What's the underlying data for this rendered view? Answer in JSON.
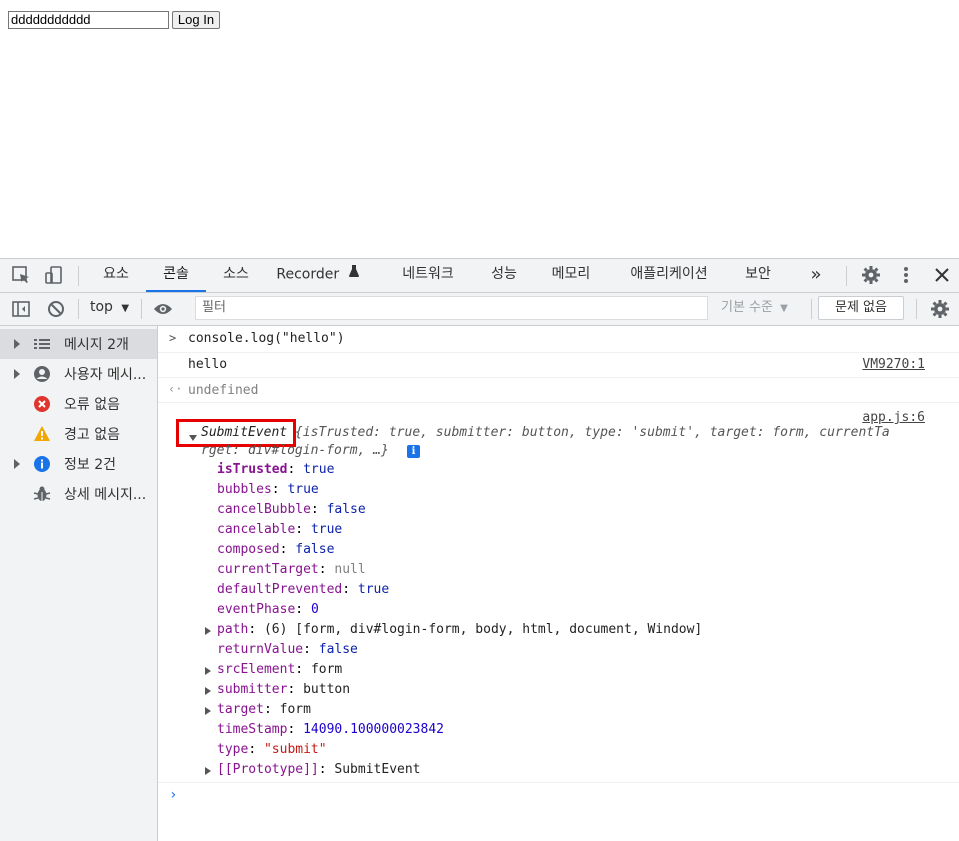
{
  "page": {
    "input_value": "ddddddddddd",
    "login_button": "Log In"
  },
  "devtools": {
    "tabs": [
      "요소",
      "콘솔",
      "소스",
      "Recorder",
      "네트워크",
      "성능",
      "메모리",
      "애플리케이션",
      "보안"
    ],
    "more_tabs": "»",
    "active_tab": "콘솔",
    "toolbar": {
      "context": "top",
      "filter_placeholder": "필터",
      "level": "기본 수준",
      "issues": "문제 없음"
    },
    "sidebar": [
      {
        "label": "메시지 2개",
        "icon": "list-icon",
        "expandable": true,
        "selected": true
      },
      {
        "label": "사용자 메시...",
        "icon": "user-icon",
        "expandable": true
      },
      {
        "label": "오류 없음",
        "icon": "error-icon",
        "expandable": false
      },
      {
        "label": "경고 없음",
        "icon": "warning-icon",
        "expandable": false
      },
      {
        "label": "정보 2건",
        "icon": "info-icon",
        "expandable": true
      },
      {
        "label": "상세 메시지...",
        "icon": "bug-icon",
        "expandable": false
      }
    ],
    "console": {
      "command": "console.log(\"hello\")",
      "output": "hello",
      "output_src": "VM9270:1",
      "return_value": "undefined",
      "event_src": "app.js:6",
      "event_name": "SubmitEvent",
      "event_summary_1": " {isTrusted: true, submitter: button, type: 'submit', target: form, currentTa",
      "event_summary_2": "rget: div#login-form, …}",
      "props": [
        {
          "key": "isTrusted",
          "value": "true",
          "vtype": "bool",
          "bold": true
        },
        {
          "key": "bubbles",
          "value": "true",
          "vtype": "bool"
        },
        {
          "key": "cancelBubble",
          "value": "false",
          "vtype": "bool"
        },
        {
          "key": "cancelable",
          "value": "true",
          "vtype": "bool"
        },
        {
          "key": "composed",
          "value": "false",
          "vtype": "bool"
        },
        {
          "key": "currentTarget",
          "value": "null",
          "vtype": "null"
        },
        {
          "key": "defaultPrevented",
          "value": "true",
          "vtype": "bool"
        },
        {
          "key": "eventPhase",
          "value": "0",
          "vtype": "num"
        },
        {
          "key": "path",
          "value": "(6) [form, div#login-form, body, html, document, Window]",
          "vtype": "obj",
          "expandable": true
        },
        {
          "key": "returnValue",
          "value": "false",
          "vtype": "bool"
        },
        {
          "key": "srcElement",
          "value": "form",
          "vtype": "obj",
          "expandable": true
        },
        {
          "key": "submitter",
          "value": "button",
          "vtype": "obj",
          "expandable": true
        },
        {
          "key": "target",
          "value": "form",
          "vtype": "obj",
          "expandable": true
        },
        {
          "key": "timeStamp",
          "value": "14090.100000023842",
          "vtype": "num"
        },
        {
          "key": "type",
          "value": "\"submit\"",
          "vtype": "str"
        },
        {
          "key": "[[Prototype]]",
          "value": "SubmitEvent",
          "vtype": "plain",
          "expandable": true
        }
      ]
    }
  }
}
